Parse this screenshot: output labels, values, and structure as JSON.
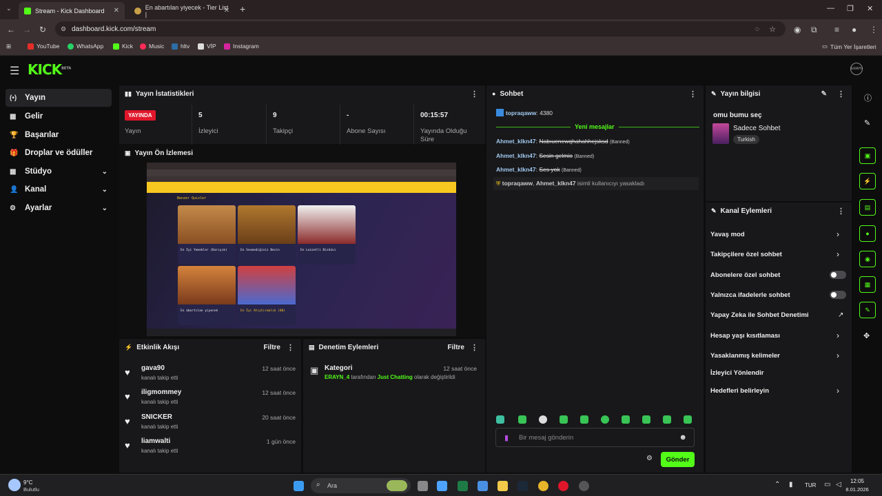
{
  "browser": {
    "tabs": [
      {
        "label": "Stream - Kick Dashboard",
        "active": true
      },
      {
        "label": "En abartılan yiyecek - Tier List |",
        "active": false
      }
    ],
    "new_tab": "+",
    "url": "dashboard.kick.com/stream",
    "bookmarks": [
      "YouTube",
      "WhatsApp",
      "Kick",
      "Music",
      "hltv",
      "VİP",
      "Instagram"
    ],
    "all_bookmarks": "Tüm Yer İşaretleri"
  },
  "header": {
    "logo": "KICK",
    "logo_beta": "BETA",
    "avatar": "ERAYN"
  },
  "sidebar": {
    "items": [
      {
        "label": "Yayın",
        "icon": "(•)"
      },
      {
        "label": "Gelir",
        "icon": "▦"
      },
      {
        "label": "Başarılar",
        "icon": "🏆"
      },
      {
        "label": "Droplar ve ödüller",
        "icon": "🎁"
      },
      {
        "label": "Stüdyo",
        "icon": "▦"
      },
      {
        "label": "Kanal",
        "icon": "👤"
      },
      {
        "label": "Ayarlar",
        "icon": "⚙"
      }
    ]
  },
  "stats": {
    "title": "Yayın İstatistikleri",
    "live_badge": "YAYINDA",
    "live_label": "Yayın",
    "viewers": {
      "value": "5",
      "label": "İzleyici"
    },
    "followers": {
      "value": "9",
      "label": "Takipçi"
    },
    "subs": {
      "value": "-",
      "label": "Abone Sayısı"
    },
    "uptime": {
      "value": "00:15:57",
      "label": "Yayında Olduğu Süre"
    }
  },
  "preview": {
    "title": "Yayın Ön İzlemesi",
    "section": "Benzer Quizler",
    "cards": [
      "En İyi Yemekler (Karışık)",
      "En Sevmediğiniz Besin",
      "En Lezzetli Bisküvi",
      "En abartılan yiyecek",
      "En İyi Atıştırmalık (80)"
    ]
  },
  "activity": {
    "title": "Etkinlik Akışı",
    "filter": "Filtre",
    "items": [
      {
        "name": "gava90",
        "action": "kanalı takip etti",
        "time": "12 saat önce"
      },
      {
        "name": "iligmommey",
        "action": "kanalı takip etti",
        "time": "12 saat önce"
      },
      {
        "name": "SNICKER",
        "action": "kanalı takip etti",
        "time": "20 saat önce"
      },
      {
        "name": "liamwalti",
        "action": "kanalı takip etti",
        "time": "1 gün önce"
      }
    ]
  },
  "moderation": {
    "title": "Denetim Eylemleri",
    "filter": "Filtre",
    "item_title": "Kategori",
    "item_time": "12 saat önce",
    "item_user": "ERAYN_4",
    "item_mid": "tarafından",
    "item_cat": "Just Chatting",
    "item_end": "olarak değiştirildi"
  },
  "chat": {
    "title": "Sohbet",
    "top_user": "topraqaww",
    "top_text": ": 4380",
    "new_messages": "Yeni mesajlar",
    "messages": [
      {
        "user": "Ahmet_klkn47",
        "text": "Nabıuenewqhahahhejsksd",
        "tag": "(Banned)"
      },
      {
        "user": "Ahmet_klkn47",
        "text": "Sesin gelmio",
        "tag": "(Banned)"
      },
      {
        "user": "Ahmet_klkn47",
        "text": "Ses yok",
        "tag": "(Banned)"
      }
    ],
    "ban_notice": {
      "mod": "topraqaww",
      "user": "Ahmet_klkn47",
      "text": "isimli kullanıcıyı yasakladı"
    },
    "placeholder": "Bir mesaj gönderin",
    "send": "Gönder"
  },
  "stream_info": {
    "title": "Yayın bilgisi",
    "stream_title": "omu bumu seç",
    "category": "Sadece Sohbet",
    "tag": "Turkish"
  },
  "channel_actions": {
    "title": "Kanal Eylemleri",
    "items": [
      {
        "label": "Yavaş mod",
        "kind": "arrow"
      },
      {
        "label": "Takipçilere özel sohbet",
        "kind": "arrow"
      },
      {
        "label": "Abonelere özel sohbet",
        "kind": "toggle"
      },
      {
        "label": "Yalnızca ifadelerle sohbet",
        "kind": "toggle"
      },
      {
        "label": "Yapay Zeka ile Sohbet Denetimi",
        "kind": "external"
      },
      {
        "label": "Hesap yaşı kısıtlaması",
        "kind": "arrow"
      },
      {
        "label": "Yasaklanmış kelimeler",
        "kind": "arrow"
      },
      {
        "label": "İzleyici Yönlendir",
        "kind": "none"
      },
      {
        "label": "Hedefleri belirleyin",
        "kind": "arrow"
      }
    ]
  },
  "taskbar": {
    "weather_temp": "9°C",
    "weather_desc": "Bulutlu",
    "search": "Ara",
    "lang": "TUR",
    "time": "12:05",
    "date": "8.01.2026"
  },
  "colors": {
    "accent": "#53fc18",
    "live": "#e0162b",
    "panel": "#18181a",
    "bg": "#0d0d0e"
  }
}
